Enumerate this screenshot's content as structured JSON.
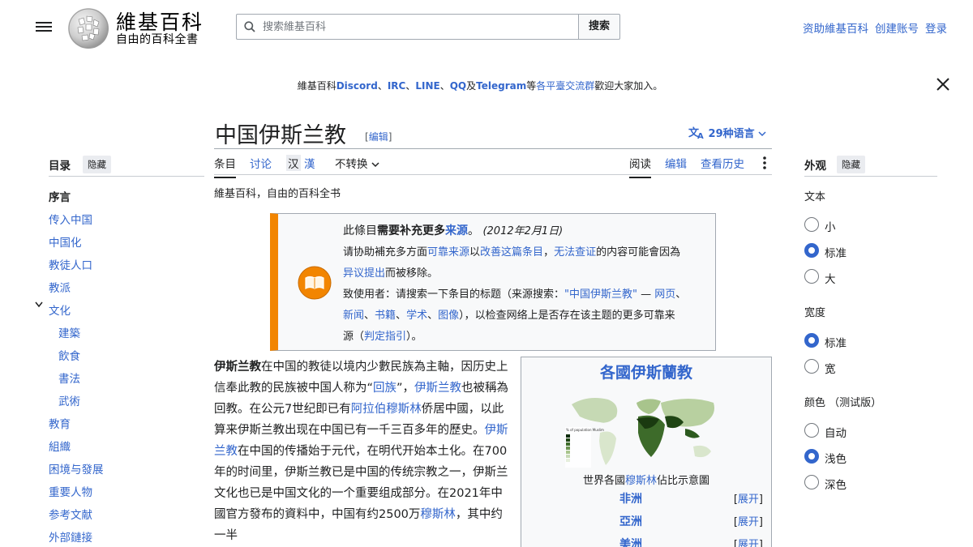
{
  "header": {
    "logo_wordmark": "維基百科",
    "logo_tagline": "自由的百科全書",
    "search_placeholder": "搜索維基百科",
    "search_button": "搜索",
    "user_links": [
      "资助維基百科",
      "创建账号",
      "登录"
    ]
  },
  "sitenotice": {
    "prefix": "維基百科",
    "discord": "Discord",
    "sep1": "、",
    "irc": "IRC",
    "sep2": "、",
    "line": "LINE",
    "sep3": "、",
    "qq": "QQ",
    "and": "及",
    "telegram": "Telegram",
    "deng": "等",
    "groups": "各平臺交流群",
    "suffix": "歡迎大家加入。"
  },
  "article": {
    "title": "中国伊斯兰教",
    "edit_link": "[编辑]",
    "languages": "29种语言"
  },
  "tabs": {
    "article": "条目",
    "talk": "讨论",
    "hans": "汉",
    "hant": "漢",
    "variant": "不转换",
    "read": "阅读",
    "edit": "编辑",
    "history": "查看历史"
  },
  "toc": {
    "title": "目录",
    "hide": "隐藏",
    "items": [
      "序言",
      "传入中国",
      "中国化",
      "教徒人口",
      "教派",
      "文化",
      "建築",
      "飲食",
      "書法",
      "武術",
      "教育",
      "組織",
      "困境与發展",
      "重要人物",
      "参考文献",
      "外部鏈接"
    ]
  },
  "content": {
    "tagline": "維基百科，自由的百科全书",
    "ambox": {
      "l1_a": "此條目",
      "l1_b": "需要补充更多",
      "l1_c": "来源",
      "l1_d": "。",
      "l1_date": "(2012年2月1日)",
      "l2_a": "请协助補充多方面",
      "l2_b": "可靠来源",
      "l2_c": "以",
      "l2_d": "改善这篇条目",
      "l2_e": "，",
      "l2_f": "无法查证",
      "l2_g": "的内容可能會因為",
      "l3_a": "异议提出",
      "l3_b": "而被移除。",
      "l4_a": "致使用者：请搜索一下条目的标题（来源搜索：",
      "l4_b": "\"中国伊斯兰教\"",
      "l4_c": " — ",
      "l4_d": "网页",
      "l4_e": "、",
      "l5_a": "新闻",
      "l5_b": "、",
      "l5_c": "书籍",
      "l5_d": "、",
      "l5_e": "学术",
      "l5_f": "、",
      "l5_g": "图像",
      "l5_h": "），以检查网络上是否存在该主题的更多可靠来",
      "l6_a": "源（",
      "l6_b": "判定指引",
      "l6_c": "）。"
    },
    "body": {
      "p1": "伊斯兰教",
      "p2": "在中国的教徒以境内少數民族為主軸，因历史上信奉此教的民族被中国人称为“",
      "p3": "回族",
      "p4": "”，",
      "p5": "伊斯兰教",
      "p6": "也被稱為回教。在公元7世纪即已有",
      "p7": "阿拉伯穆斯林",
      "p8": "侨居中國，以此算来伊斯兰教出现在中国已有一千三百多年的歷史。",
      "p9": "伊斯兰教",
      "p10": "在中国的传播始于元代，在明代开始本土化。在700年的时间里，伊斯兰教已是中国的传统宗教之一，伊斯兰文化也已是中国文化的一个重要组成部分。在2021年中國官方發布的資料中，中国有约2500万",
      "p11": "穆斯林",
      "p12": "，其中约一半"
    }
  },
  "infobox": {
    "title": "各國伊斯蘭教",
    "map_legend_title": "% of population Muslim",
    "caption_a": "世界各國",
    "caption_b": "穆斯林",
    "caption_c": "佔比示意圖",
    "rows": [
      {
        "name": "非洲",
        "expand": "展开"
      },
      {
        "name": "亞洲",
        "expand": "展开"
      },
      {
        "name": "美洲",
        "expand": "展开"
      }
    ]
  },
  "appearance": {
    "title": "外观",
    "hide": "隐藏",
    "text_label": "文本",
    "text_options": [
      "小",
      "标准",
      "大"
    ],
    "text_selected": "标准",
    "width_label": "宽度",
    "width_options": [
      "标准",
      "宽"
    ],
    "width_selected": "标准",
    "color_label": "颜色 （测试版）",
    "color_options": [
      "自动",
      "浅色",
      "深色"
    ],
    "color_selected": "浅色"
  }
}
